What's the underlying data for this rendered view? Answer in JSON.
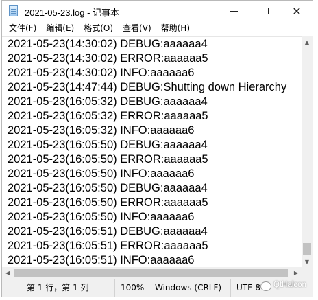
{
  "window": {
    "title": "2021-05-23.log - 记事本",
    "controls": {
      "minimize": "minimize",
      "maximize": "maximize",
      "close": "close"
    }
  },
  "menubar": {
    "items": [
      "文件(F)",
      "编辑(E)",
      "格式(O)",
      "查看(V)",
      "帮助(H)"
    ]
  },
  "editor": {
    "lines": [
      "2021-05-23(14:30:02) DEBUG:aaaaaa4",
      "2021-05-23(14:30:02) ERROR:aaaaaa5",
      "2021-05-23(14:30:02) INFO:aaaaaa6",
      "2021-05-23(14:47:44) DEBUG:Shutting down Hierarchy",
      "2021-05-23(16:05:32) DEBUG:aaaaaa4",
      "2021-05-23(16:05:32) ERROR:aaaaaa5",
      "2021-05-23(16:05:32) INFO:aaaaaa6",
      "2021-05-23(16:05:50) DEBUG:aaaaaa4",
      "2021-05-23(16:05:50) ERROR:aaaaaa5",
      "2021-05-23(16:05:50) INFO:aaaaaa6",
      "2021-05-23(16:05:50) DEBUG:aaaaaa4",
      "2021-05-23(16:05:50) ERROR:aaaaaa5",
      "2021-05-23(16:05:50) INFO:aaaaaa6",
      "2021-05-23(16:05:51) DEBUG:aaaaaa4",
      "2021-05-23(16:05:51) ERROR:aaaaaa5",
      "2021-05-23(16:05:51) INFO:aaaaaa6"
    ]
  },
  "statusbar": {
    "position": "第 1 行，第 1 列",
    "zoom": "100%",
    "line_ending": "Windows (CRLF)",
    "encoding": "UTF-8"
  },
  "watermark": {
    "text": "QtHalcon"
  },
  "icons": {
    "app": "notepad-icon",
    "scroll_up": "chevron-up-icon",
    "scroll_down": "chevron-down-icon",
    "scroll_left": "chevron-left-icon",
    "scroll_right": "chevron-right-icon"
  }
}
